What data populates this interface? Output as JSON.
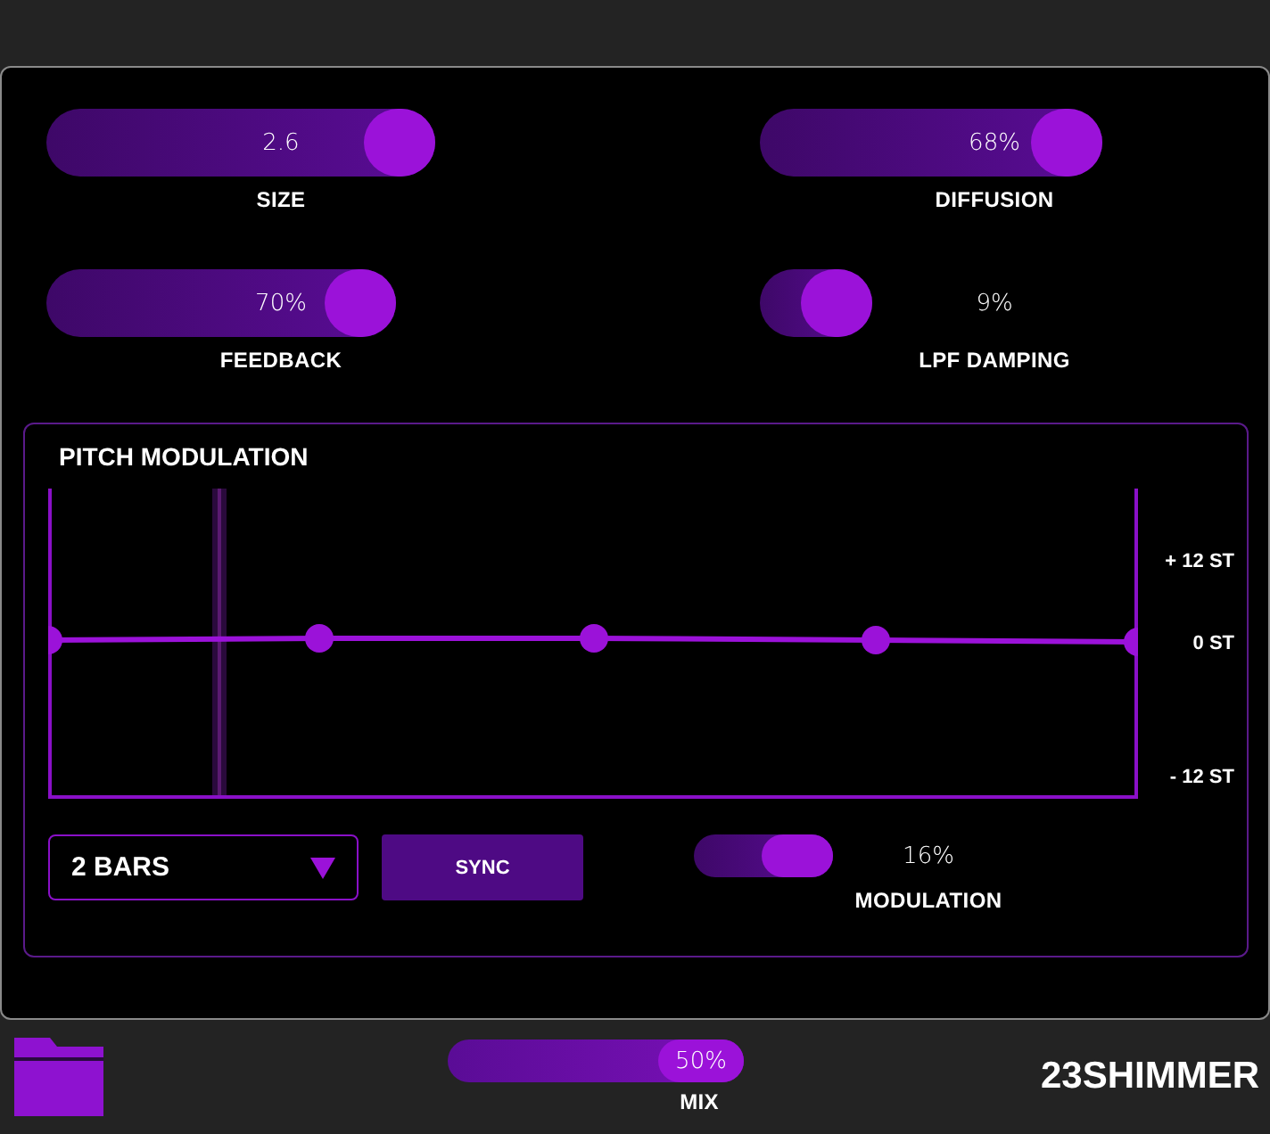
{
  "knobs": [
    {
      "label": "SIZE",
      "reading": "2.6"
    },
    {
      "label": "DIFFUSION",
      "reading": "68%"
    },
    {
      "label": "FEEDBACK",
      "reading": "70%"
    },
    {
      "label": "LPF DAMPING",
      "reading": "9%"
    }
  ],
  "pitch_modulation": {
    "title": "PITCH MODULATION",
    "axis_labels": [
      "+ 12 ST",
      "0 ST",
      "- 12 ST"
    ],
    "length_dropdown": {
      "value": "2 BARS"
    },
    "sync_button": "SYNC",
    "modulation": {
      "label": "MODULATION",
      "reading": "16%"
    }
  },
  "footer": {
    "mix": {
      "label": "MIX",
      "reading": "50%"
    },
    "brand": "23SHIMMER"
  }
}
